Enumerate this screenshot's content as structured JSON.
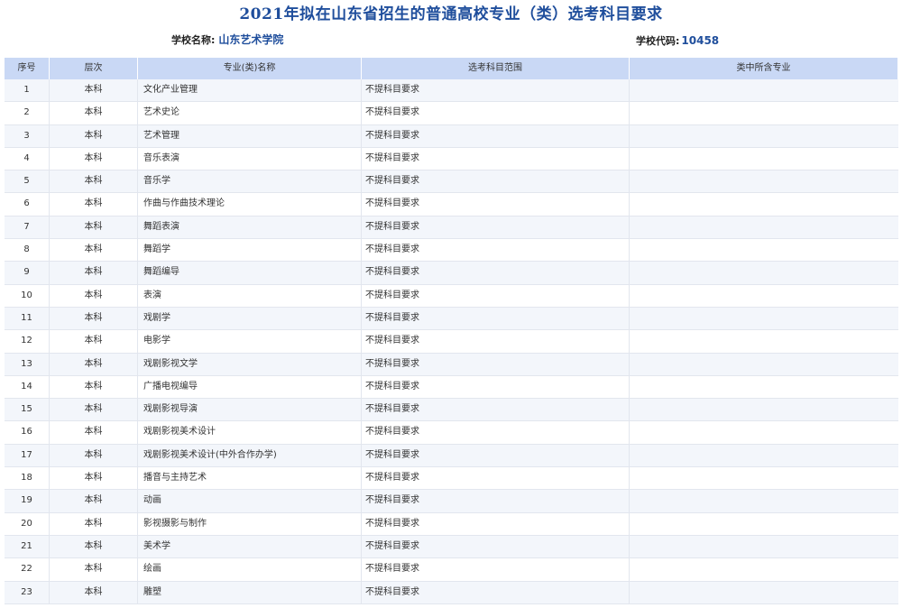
{
  "title": "2021年拟在山东省招生的普通高校专业（类）选考科目要求",
  "school": {
    "label": "学校名称:",
    "name": "山东艺术学院"
  },
  "code": {
    "label": "学校代码:",
    "value": "10458"
  },
  "table": {
    "headers": [
      "序号",
      "层次",
      "专业(类)名称",
      "选考科目范围",
      "类中所含专业"
    ],
    "rows": [
      [
        "1",
        "本科",
        "文化产业管理",
        "不提科目要求",
        ""
      ],
      [
        "2",
        "本科",
        "艺术史论",
        "不提科目要求",
        ""
      ],
      [
        "3",
        "本科",
        "艺术管理",
        "不提科目要求",
        ""
      ],
      [
        "4",
        "本科",
        "音乐表演",
        "不提科目要求",
        ""
      ],
      [
        "5",
        "本科",
        "音乐学",
        "不提科目要求",
        ""
      ],
      [
        "6",
        "本科",
        "作曲与作曲技术理论",
        "不提科目要求",
        ""
      ],
      [
        "7",
        "本科",
        "舞蹈表演",
        "不提科目要求",
        ""
      ],
      [
        "8",
        "本科",
        "舞蹈学",
        "不提科目要求",
        ""
      ],
      [
        "9",
        "本科",
        "舞蹈编导",
        "不提科目要求",
        ""
      ],
      [
        "10",
        "本科",
        "表演",
        "不提科目要求",
        ""
      ],
      [
        "11",
        "本科",
        "戏剧学",
        "不提科目要求",
        ""
      ],
      [
        "12",
        "本科",
        "电影学",
        "不提科目要求",
        ""
      ],
      [
        "13",
        "本科",
        "戏剧影视文学",
        "不提科目要求",
        ""
      ],
      [
        "14",
        "本科",
        "广播电视编导",
        "不提科目要求",
        ""
      ],
      [
        "15",
        "本科",
        "戏剧影视导演",
        "不提科目要求",
        ""
      ],
      [
        "16",
        "本科",
        "戏剧影视美术设计",
        "不提科目要求",
        ""
      ],
      [
        "17",
        "本科",
        "戏剧影视美术设计(中外合作办学)",
        "不提科目要求",
        ""
      ],
      [
        "18",
        "本科",
        "播音与主持艺术",
        "不提科目要求",
        ""
      ],
      [
        "19",
        "本科",
        "动画",
        "不提科目要求",
        ""
      ],
      [
        "20",
        "本科",
        "影视摄影与制作",
        "不提科目要求",
        ""
      ],
      [
        "21",
        "本科",
        "美术学",
        "不提科目要求",
        ""
      ],
      [
        "22",
        "本科",
        "绘画",
        "不提科目要求",
        ""
      ],
      [
        "23",
        "本科",
        "雕塑",
        "不提科目要求",
        ""
      ]
    ]
  },
  "colors": {
    "title": "#1f4e9c",
    "header_bg": "#c9d8f5",
    "stripe": "#f3f6fb"
  }
}
